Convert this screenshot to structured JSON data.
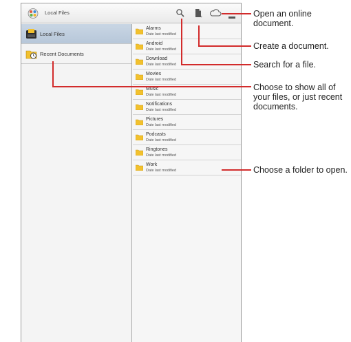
{
  "app": {
    "title": "Local Files"
  },
  "toolbar": {
    "icons": [
      "search-icon",
      "new-document-icon",
      "cloud-icon"
    ]
  },
  "sidebar": {
    "items": [
      {
        "label": "Local Files",
        "icon": "folder-device-icon",
        "selected": true
      },
      {
        "label": "Recent Documents",
        "icon": "recent-documents-icon",
        "selected": false
      }
    ]
  },
  "folders": [
    {
      "name": "Alarms",
      "meta": "Date last modified"
    },
    {
      "name": "Android",
      "meta": "Date last modified"
    },
    {
      "name": "Download",
      "meta": "Date last modified"
    },
    {
      "name": "Movies",
      "meta": "Date last modified"
    },
    {
      "name": "Music",
      "meta": "Date last modified"
    },
    {
      "name": "Notifications",
      "meta": "Date last modified"
    },
    {
      "name": "Pictures",
      "meta": "Date last modified"
    },
    {
      "name": "Podcasts",
      "meta": "Date last modified"
    },
    {
      "name": "Ringtones",
      "meta": "Date last modified"
    },
    {
      "name": "Work",
      "meta": "Date last modified"
    }
  ],
  "callouts": {
    "online": "Open an online document.",
    "create": "Create a document.",
    "search": "Search for a file.",
    "choose": "Choose to show all of your files, or just recent documents.",
    "folder": "Choose a folder to open."
  },
  "colors": {
    "accent": "#d22b2b",
    "selected_item": "#c3d1e1",
    "folder": "#f2c12e"
  }
}
